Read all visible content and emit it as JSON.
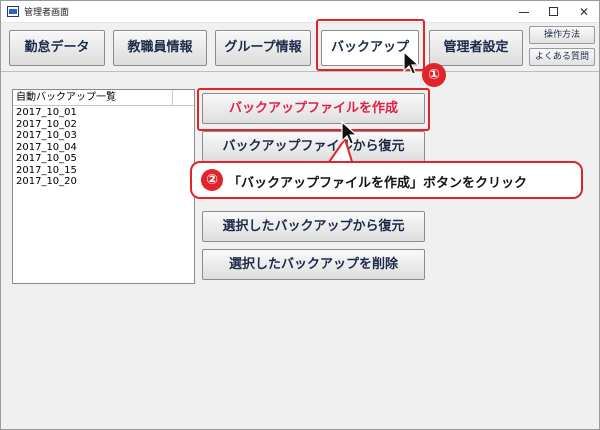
{
  "window": {
    "title": "管理者画面",
    "min_icon": "minimize-icon",
    "max_icon": "maximize-icon",
    "close_icon": "close-icon",
    "close_glyph": "✕"
  },
  "tabs": [
    {
      "label": "勤怠データ"
    },
    {
      "label": "教職員情報"
    },
    {
      "label": "グループ情報"
    },
    {
      "label": "バックアップ"
    },
    {
      "label": "管理者設定"
    }
  ],
  "help": {
    "manual": "操作方法",
    "faq": "よくある質問"
  },
  "backup_list": {
    "header": "自動バックアップ一覧",
    "items": [
      "2017_10_01",
      "2017_10_02",
      "2017_10_03",
      "2017_10_04",
      "2017_10_05",
      "2017_10_15",
      "2017_10_20"
    ]
  },
  "actions": {
    "create": "バックアップファイルを作成",
    "restore_file": "バックアップファイルから復元",
    "restore_selected": "選択したバックアップから復元",
    "delete_selected": "選択したバックアップを削除"
  },
  "annotations": {
    "step1_number": "①",
    "step2_number": "②",
    "step2_text": "「バックアップファイルを作成」ボタンをクリック"
  },
  "colors": {
    "highlight": "#e0242a",
    "create_label": "#e0214b",
    "button_text": "#1c2a4a"
  }
}
